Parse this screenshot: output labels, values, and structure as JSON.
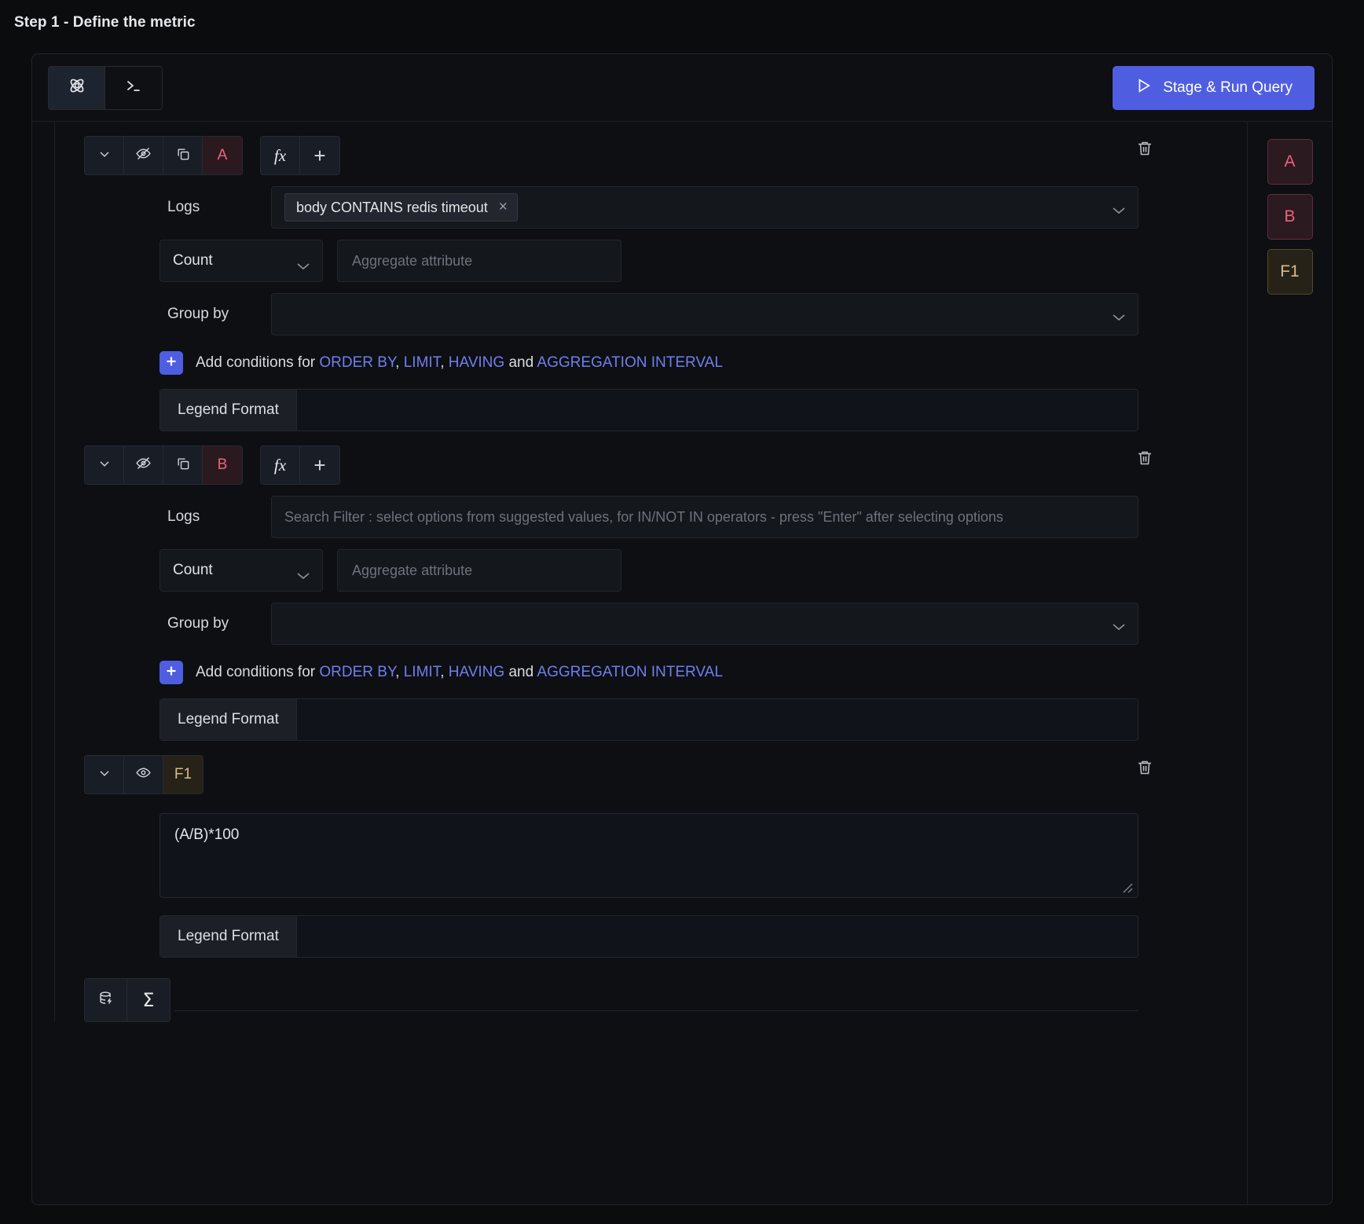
{
  "page": {
    "step_title": "Step 1 - Define the metric"
  },
  "toolbar": {
    "mode_builder_icon": "atom-icon",
    "mode_query_icon": "terminal-icon",
    "run_label": "Stage & Run Query",
    "run_icon": "play-icon",
    "run_color": "#4f5ee0"
  },
  "legend_panel": {
    "badges": [
      {
        "label": "A",
        "kind": "query",
        "color": "#f0607f"
      },
      {
        "label": "B",
        "kind": "query",
        "color": "#f0607f"
      },
      {
        "label": "F1",
        "kind": "formula",
        "color": "#dcb88a"
      }
    ]
  },
  "common": {
    "data_source_label": "Logs",
    "aggregate_select_value": "Count",
    "aggregate_attribute_placeholder": "Aggregate attribute",
    "group_by_label": "Group by",
    "group_by_value": "",
    "legend_format_label": "Legend Format",
    "legend_format_value": "",
    "add_conditions": {
      "prefix": "Add conditions for",
      "links": [
        "ORDER BY",
        "LIMIT",
        "HAVING",
        "AGGREGATION INTERVAL"
      ],
      "conjunction": "and",
      "link_color": "#6f7ff0"
    },
    "search_filter_placeholder": "Search Filter : select options from suggested values, for IN/NOT IN operators - press \"Enter\" after selecting options",
    "delete_icon": "trash-icon",
    "collapse_icon": "chevron-down-icon",
    "copy_icon": "copy-icon",
    "fx_label": "fx",
    "add_icon": "plus-icon"
  },
  "queries": [
    {
      "name": "A",
      "visibility_icon": "eye-off-icon",
      "visible": false,
      "filter_chip": "body CONTAINS redis timeout",
      "filter_chip_remove": "×",
      "has_filter": true
    },
    {
      "name": "B",
      "visibility_icon": "eye-off-icon",
      "visible": false,
      "filter_chip": "",
      "has_filter": false
    }
  ],
  "formulas": [
    {
      "name": "F1",
      "visibility_icon": "eye-icon",
      "visible": true,
      "expression": "(A/B)*100",
      "legend_format_value": ""
    }
  ],
  "bottom_toolbar": {
    "add_query_icon": "database-lightning-icon",
    "add_formula_icon": "sigma-icon",
    "add_formula_label": "Σ"
  }
}
